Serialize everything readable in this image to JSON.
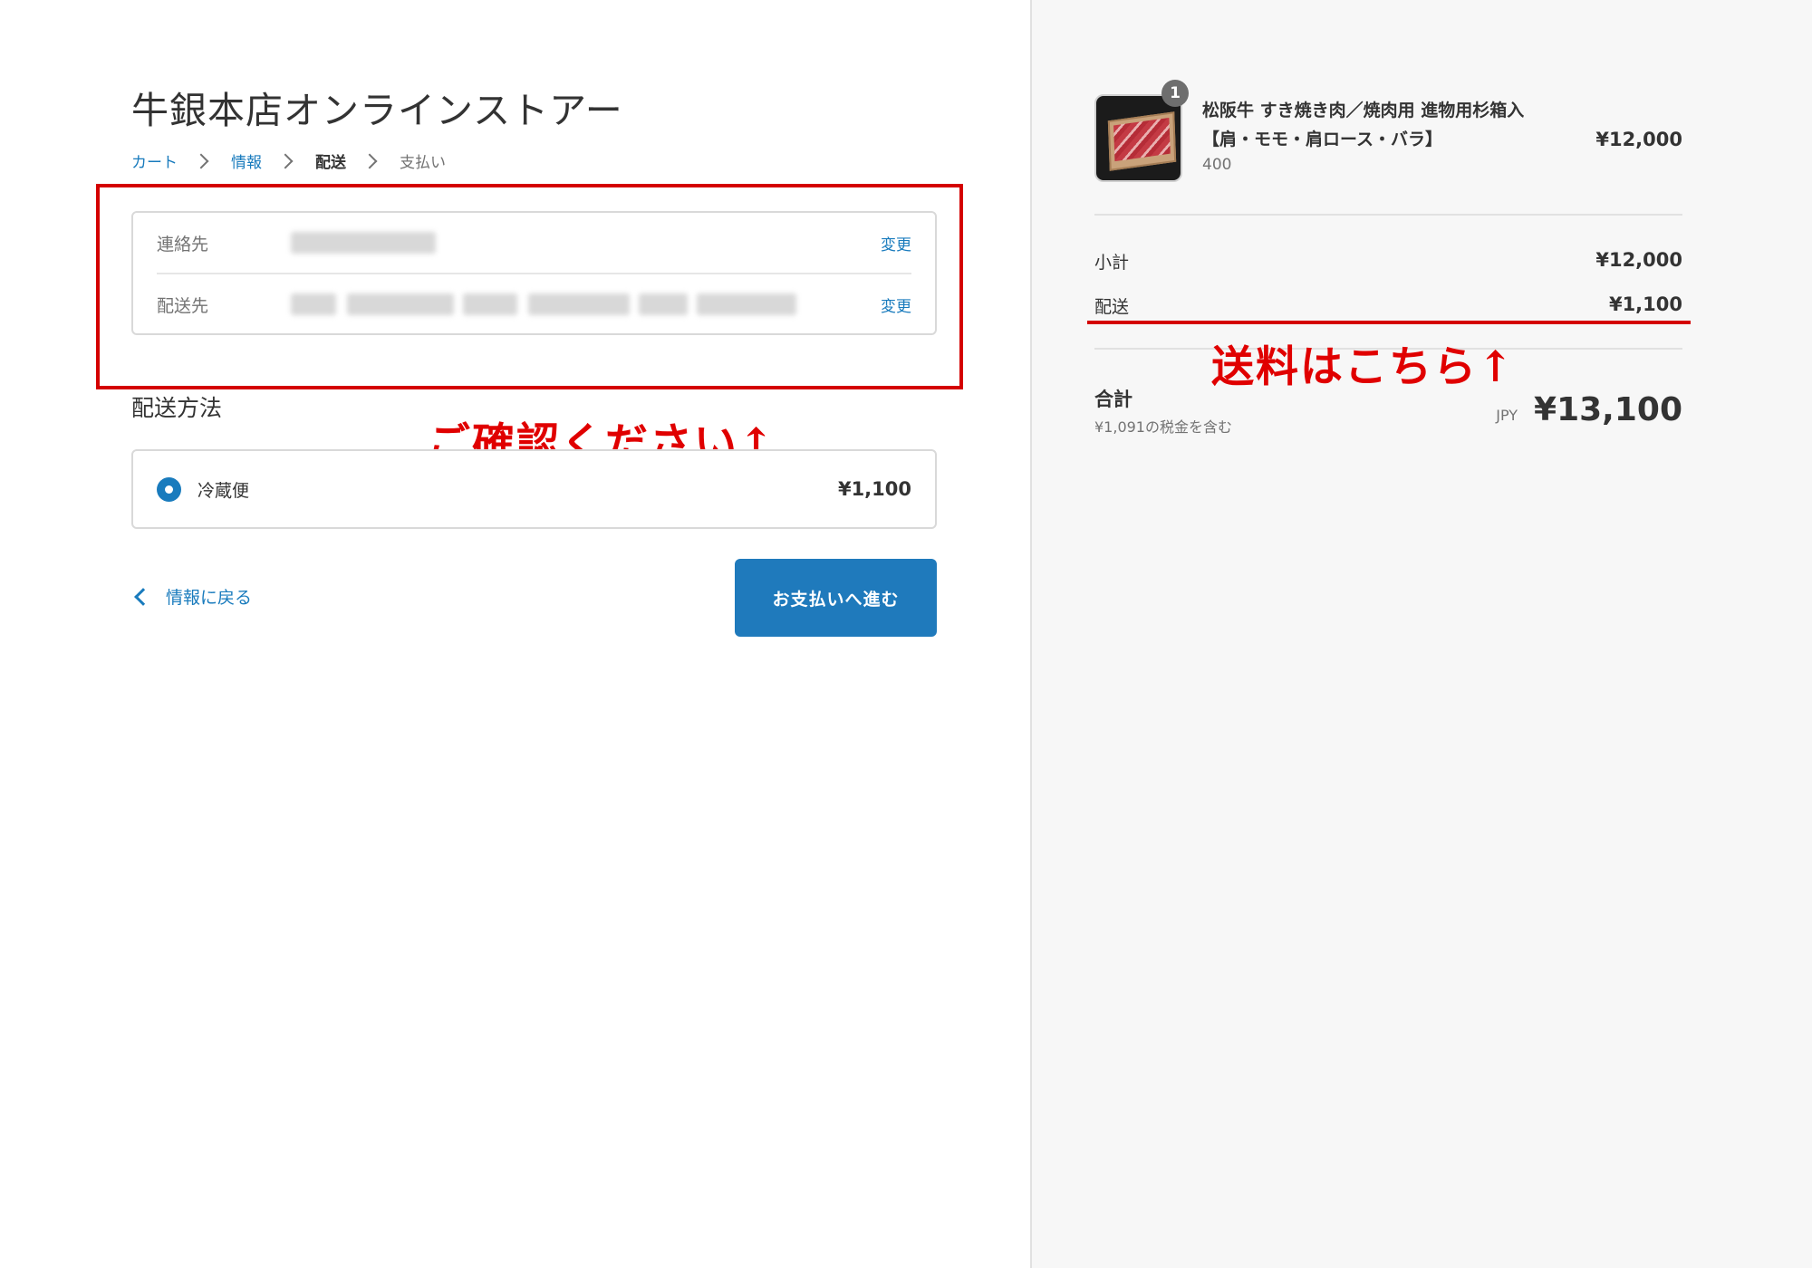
{
  "store": {
    "title": "牛銀本店オンラインストアー"
  },
  "breadcrumb": {
    "cart": "カート",
    "info": "情報",
    "shipping": "配送",
    "payment": "支払い"
  },
  "review": {
    "contact_label": "連絡先",
    "address_label": "配送先",
    "change_label": "変更"
  },
  "shipping_method": {
    "heading": "配送方法",
    "option_name": "冷蔵便",
    "option_price": "¥1,100"
  },
  "annotations": {
    "confirm": "ご確認ください↑",
    "shipping_fee": "送料はこちら↑",
    "color": "#e00000"
  },
  "nav": {
    "back_label": "情報に戻る",
    "continue_label": "お支払いへ進む"
  },
  "order_summary": {
    "product": {
      "quantity": "1",
      "name_line1": "松阪牛 すき焼き肉／焼肉用 進物用杉箱入",
      "name_line2": "【肩・モモ・肩ロース・バラ】",
      "variant": "400",
      "price": "¥12,000"
    },
    "subtotal_label": "小計",
    "subtotal_value": "¥12,000",
    "shipping_label": "配送",
    "shipping_value": "¥1,100",
    "total_label": "合計",
    "tax_note": "¥1,091の税金を含む",
    "currency": "JPY",
    "total_value": "¥13,100"
  },
  "colors": {
    "accent": "#197bbd",
    "button": "#1f7abc",
    "annotation_red": "#d40000",
    "sidebar_bg": "#f7f7f7"
  }
}
